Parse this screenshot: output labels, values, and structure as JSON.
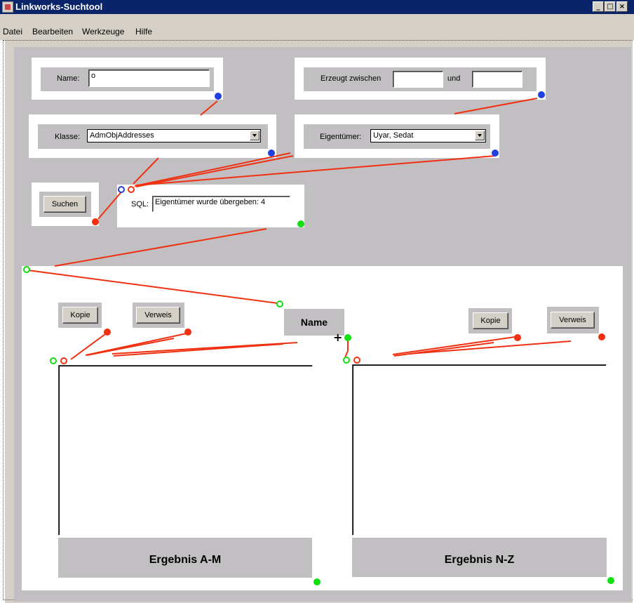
{
  "window": {
    "title": "Linkworks-Suchtool",
    "controls": [
      "_",
      "□",
      "×"
    ]
  },
  "menu": [
    "Datei",
    "Bearbeiten",
    "Werkzeuge",
    "Hilfe"
  ],
  "name_field": {
    "label": "Name:",
    "value": "o"
  },
  "date_range": {
    "label": "Erzeugt zwischen",
    "and_label": "und",
    "from": "",
    "to": ""
  },
  "klasse": {
    "label": "Klasse:",
    "value": "AdmObjAddresses"
  },
  "eigentuemer": {
    "label": "Eigentümer:",
    "value": "Uyar, Sedat"
  },
  "search_button": "Suchen",
  "sql": {
    "label": "SQL:",
    "value": "Eigentümer wurde übergeben: 4"
  },
  "name_header": "Name",
  "left_result": {
    "copy": "Kopie",
    "link": "Verweis",
    "title": "Ergebnis A-M"
  },
  "right_result": {
    "copy": "Kopie",
    "link": "Verweis",
    "title": "Ergebnis N-Z"
  },
  "colors": {
    "wire": "#f03010",
    "port_blue": "#1f3fe0",
    "port_green": "#10e010",
    "titlebar": "#0a246a"
  }
}
